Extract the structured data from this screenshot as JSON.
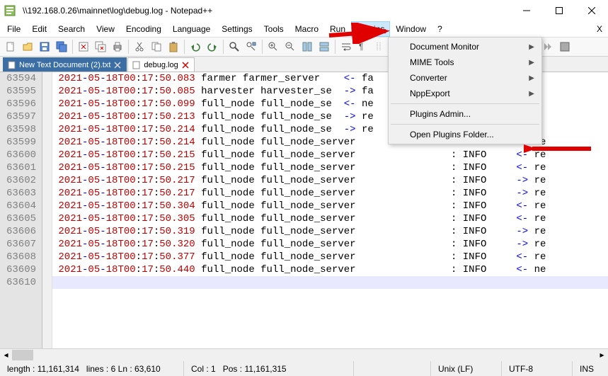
{
  "titlebar": {
    "path": "\\\\192.168.0.26\\mainnet\\log\\debug.log - Notepad++"
  },
  "menus": [
    "File",
    "Edit",
    "Search",
    "View",
    "Encoding",
    "Language",
    "Settings",
    "Tools",
    "Macro",
    "Run",
    "Plugins",
    "Window",
    "?",
    "X"
  ],
  "dropdown": {
    "items": [
      {
        "label": "Document Monitor",
        "sub": true
      },
      {
        "label": "MIME Tools",
        "sub": true
      },
      {
        "label": "Converter",
        "sub": true
      },
      {
        "label": "NppExport",
        "sub": true
      }
    ],
    "admin": "Plugins Admin...",
    "open_folder": "Open Plugins Folder..."
  },
  "tabs": [
    {
      "label": "New Text Document (2).txt",
      "active": false
    },
    {
      "label": "debug.log",
      "active": true
    }
  ],
  "log_lines": [
    {
      "ln": "63594",
      "ts": "2021-05-18T00:17:50.083",
      "body": "farmer farmer_server",
      "level": "",
      "arrow": "<-",
      "tail": "fa"
    },
    {
      "ln": "63595",
      "ts": "2021-05-18T00:17:50.085",
      "body": "harvester harvester_se",
      "level": "",
      "arrow": "->",
      "tail": "fa"
    },
    {
      "ln": "63596",
      "ts": "2021-05-18T00:17:50.099",
      "body": "full_node full_node_se",
      "level": "",
      "arrow": "<-",
      "tail": "ne"
    },
    {
      "ln": "63597",
      "ts": "2021-05-18T00:17:50.213",
      "body": "full_node full_node_se",
      "level": "",
      "arrow": "->",
      "tail": "re"
    },
    {
      "ln": "63598",
      "ts": "2021-05-18T00:17:50.214",
      "body": "full_node full_node_se",
      "level": "",
      "arrow": "->",
      "tail": "re"
    },
    {
      "ln": "63599",
      "ts": "2021-05-18T00:17:50.214",
      "body": "full_node full_node_server",
      "level": "INFO",
      "arrow": "<-",
      "tail": "ne"
    },
    {
      "ln": "63600",
      "ts": "2021-05-18T00:17:50.215",
      "body": "full_node full_node_server",
      "level": "INFO",
      "arrow": "<-",
      "tail": "re"
    },
    {
      "ln": "63601",
      "ts": "2021-05-18T00:17:50.215",
      "body": "full_node full_node_server",
      "level": "INFO",
      "arrow": "<-",
      "tail": "re"
    },
    {
      "ln": "63602",
      "ts": "2021-05-18T00:17:50.217",
      "body": "full_node full_node_server",
      "level": "INFO",
      "arrow": "->",
      "tail": "re"
    },
    {
      "ln": "63603",
      "ts": "2021-05-18T00:17:50.217",
      "body": "full_node full_node_server",
      "level": "INFO",
      "arrow": "->",
      "tail": "re"
    },
    {
      "ln": "63604",
      "ts": "2021-05-18T00:17:50.304",
      "body": "full_node full_node_server",
      "level": "INFO",
      "arrow": "<-",
      "tail": "re"
    },
    {
      "ln": "63605",
      "ts": "2021-05-18T00:17:50.305",
      "body": "full_node full_node_server",
      "level": "INFO",
      "arrow": "<-",
      "tail": "re"
    },
    {
      "ln": "63606",
      "ts": "2021-05-18T00:17:50.319",
      "body": "full_node full_node_server",
      "level": "INFO",
      "arrow": "->",
      "tail": "re"
    },
    {
      "ln": "63607",
      "ts": "2021-05-18T00:17:50.320",
      "body": "full_node full_node_server",
      "level": "INFO",
      "arrow": "->",
      "tail": "re"
    },
    {
      "ln": "63608",
      "ts": "2021-05-18T00:17:50.377",
      "body": "full_node full_node_server",
      "level": "INFO",
      "arrow": "<-",
      "tail": "re"
    },
    {
      "ln": "63609",
      "ts": "2021-05-18T00:17:50.440",
      "body": "full_node full_node_server",
      "level": "INFO",
      "arrow": "<-",
      "tail": "ne"
    },
    {
      "ln": "63610",
      "ts": "",
      "body": "",
      "level": "",
      "arrow": "",
      "tail": ""
    }
  ],
  "status": {
    "length_label": "length :",
    "length": "11,161,314",
    "lines_label": "lines :",
    "lines": "6",
    "ln_label": "Ln :",
    "ln": "63,610",
    "col_label": "Col :",
    "col": "1",
    "pos_label": "Pos :",
    "pos": "11,161,315",
    "eol": "Unix (LF)",
    "enc": "UTF-8",
    "ins": "INS"
  }
}
